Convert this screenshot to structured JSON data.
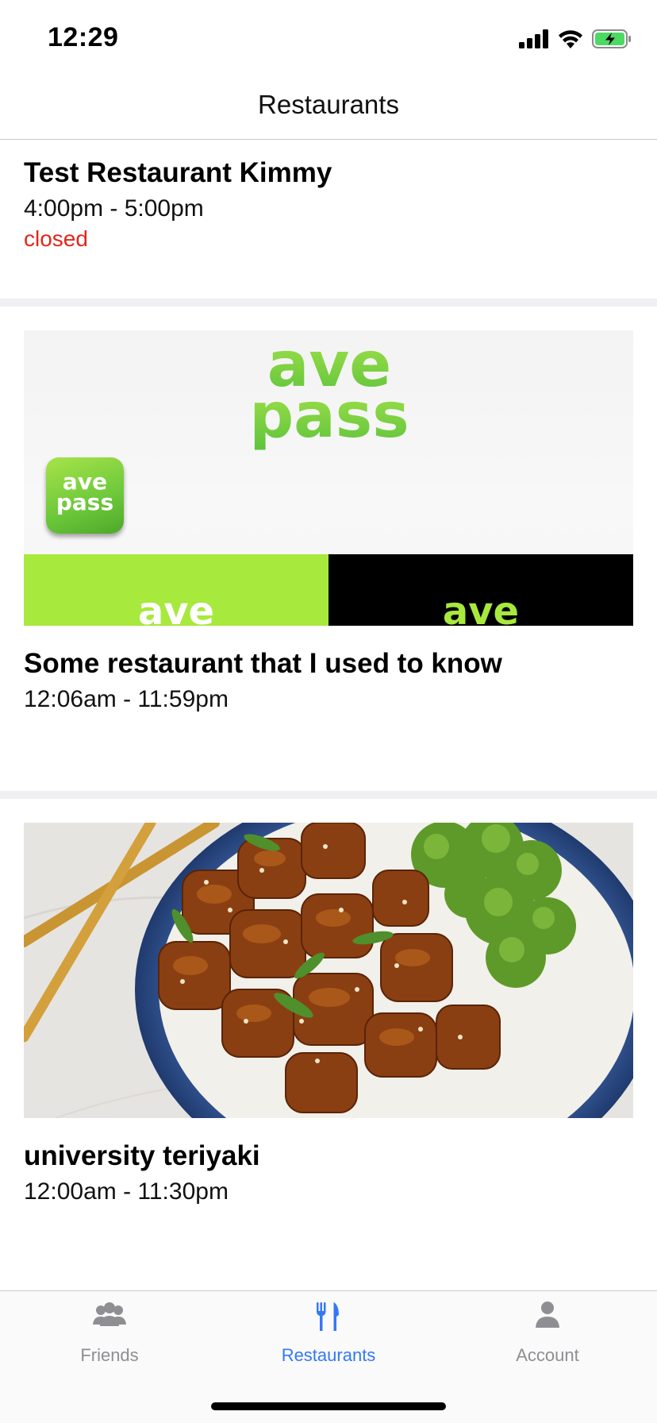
{
  "status_bar": {
    "time": "12:29"
  },
  "nav": {
    "title": "Restaurants"
  },
  "restaurants": [
    {
      "name": "Test Restaurant Kimmy",
      "hours": "4:00pm - 5:00pm",
      "status": "closed"
    },
    {
      "name": "Some restaurant that I used to know",
      "hours": "12:06am - 11:59pm",
      "image": {
        "logo_line1": "ave",
        "logo_line2": "pass",
        "strip_left": "ave",
        "strip_right": "ave"
      }
    },
    {
      "name": "university teriyaki",
      "hours": "12:00am - 11:30pm"
    }
  ],
  "tabs": [
    {
      "label": "Friends",
      "icon": "friends-icon",
      "active": false
    },
    {
      "label": "Restaurants",
      "icon": "fork-knife-icon",
      "active": true
    },
    {
      "label": "Account",
      "icon": "person-icon",
      "active": false
    }
  ],
  "colors": {
    "active_tab": "#3478f6",
    "inactive_tab": "#8e8e93",
    "closed_status": "#e0271d",
    "brand_green": "#7ed957"
  }
}
